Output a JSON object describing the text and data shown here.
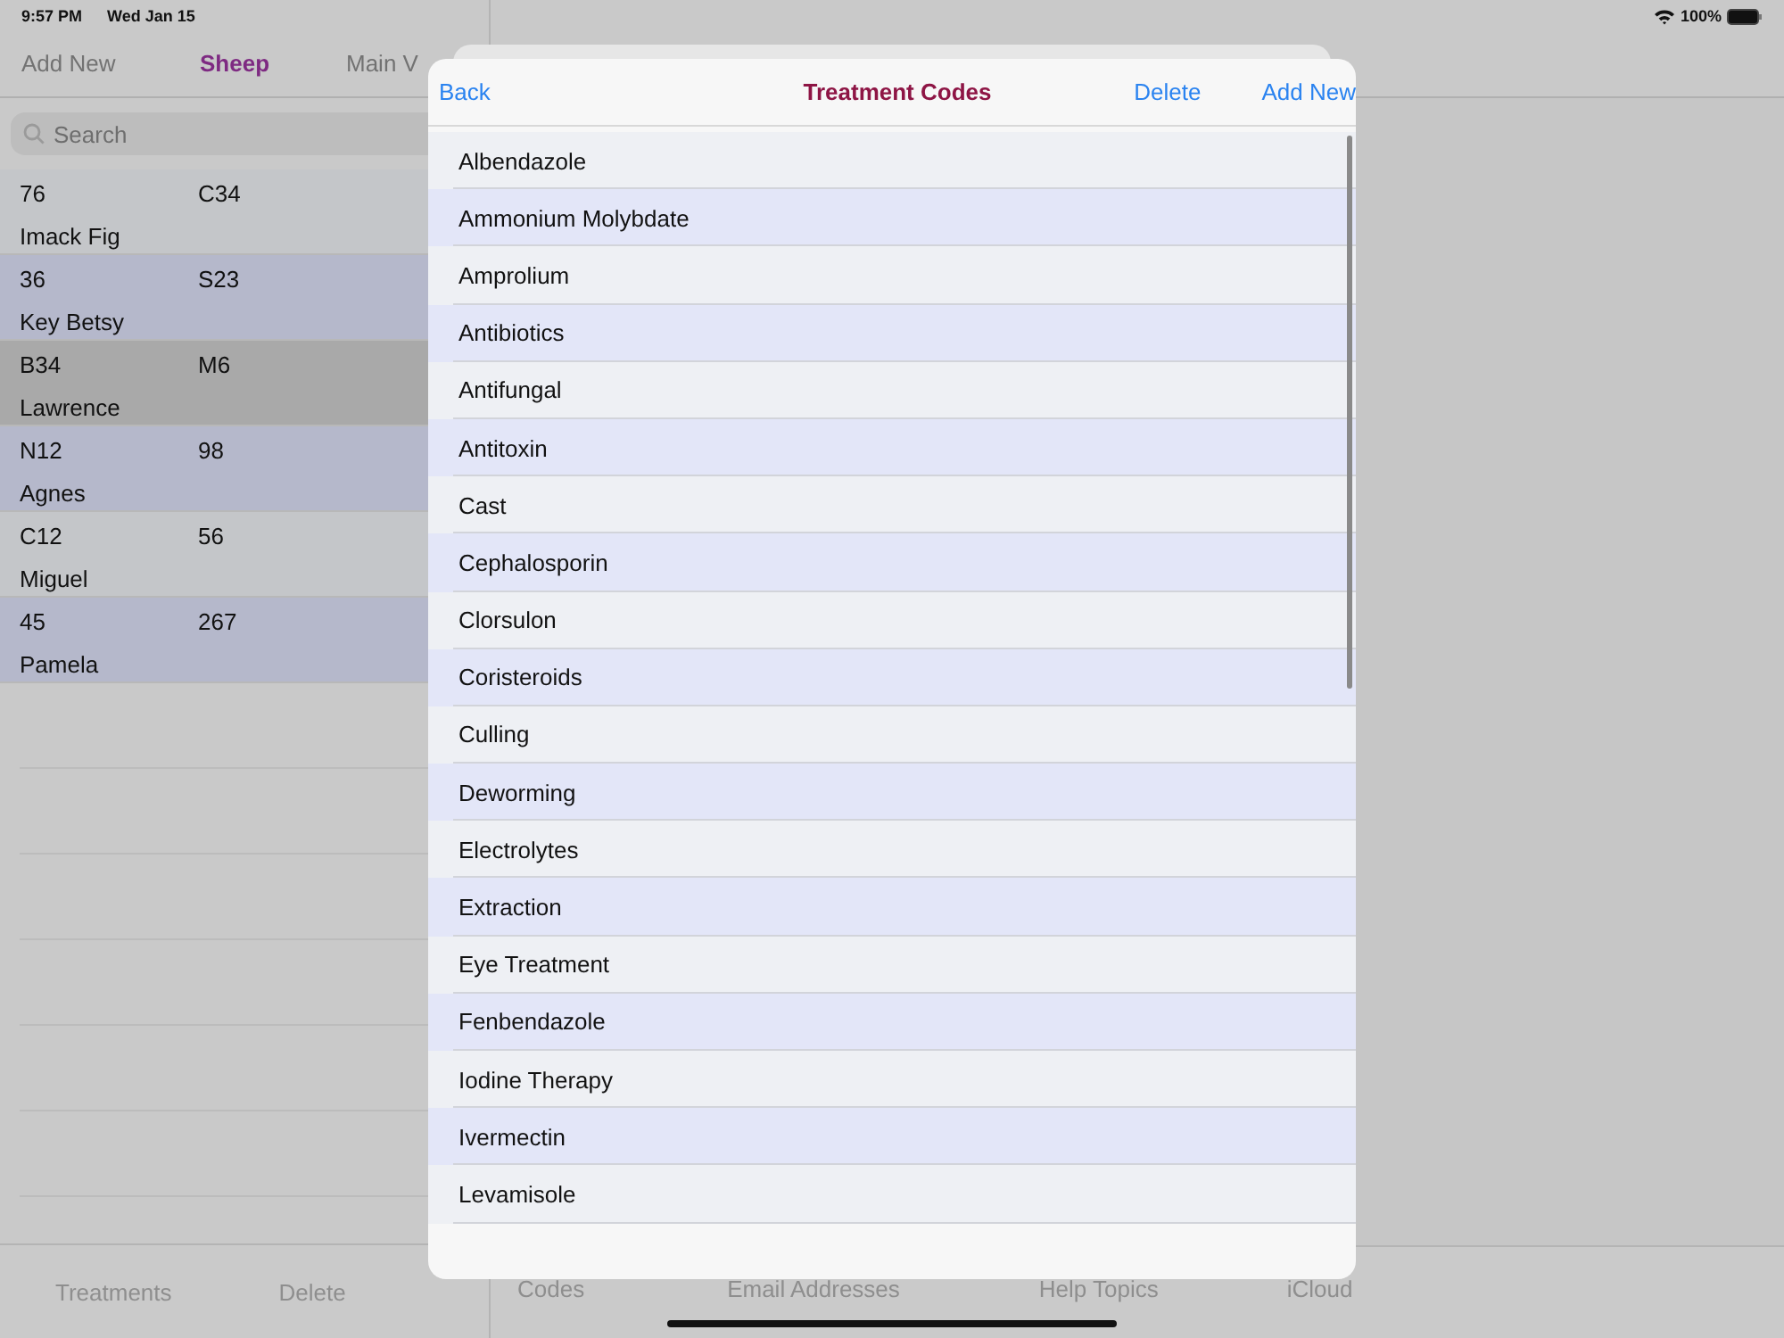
{
  "status_bar": {
    "time": "9:57 PM",
    "date": "Wed Jan 15",
    "battery": "100%"
  },
  "left_panel": {
    "tabs": [
      {
        "label": "Add New",
        "selected": false
      },
      {
        "label": "Sheep",
        "selected": true
      },
      {
        "label": "Main V",
        "selected": false
      }
    ],
    "search": {
      "placeholder": "Search"
    },
    "rows": [
      {
        "tag": "76",
        "code": "C34",
        "name": "Imack Fig",
        "selected": false
      },
      {
        "tag": "36",
        "code": "S23",
        "name": "Key Betsy",
        "selected": false
      },
      {
        "tag": "B34",
        "code": "M6",
        "name": "Lawrence",
        "selected": true
      },
      {
        "tag": "N12",
        "code": "98",
        "name": "Agnes",
        "selected": false
      },
      {
        "tag": "C12",
        "code": "56",
        "name": "Miguel",
        "selected": false
      },
      {
        "tag": "45",
        "code": "267",
        "name": "Pamela",
        "selected": false
      }
    ],
    "toolbar": [
      "Treatments",
      "Delete"
    ]
  },
  "right_toolbar": [
    "Codes",
    "Email Addresses",
    "Help Topics",
    "iCloud"
  ],
  "modal": {
    "back": "Back",
    "title": "Treatment Codes",
    "delete": "Delete",
    "add_new": "Add New",
    "items": [
      "Albendazole",
      "Ammonium Molybdate",
      "Amprolium",
      "Antibiotics",
      "Antifungal",
      "Antitoxin",
      "Cast",
      "Cephalosporin",
      "Clorsulon",
      "Coristeroids",
      "Culling",
      "Deworming",
      "Electrolytes",
      "Extraction",
      "Eye Treatment",
      "Fenbendazole",
      "Iodine Therapy",
      "Ivermectin",
      "Levamisole"
    ]
  }
}
